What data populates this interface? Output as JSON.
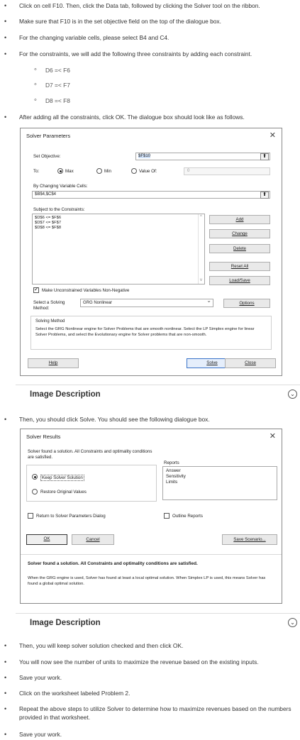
{
  "instructions": {
    "step1": "Click on cell F10. Then, click the Data tab, followed by clicking the Solver tool on the ribbon.",
    "step2": "Make sure that F10 is in the set objective field on the top of the dialogue box.",
    "step3": "For the changing variable cells, please select B4 and C4.",
    "step4": "For the constraints, we will add the following three constraints by adding each constraint.",
    "constraints": [
      "D6 =< F6",
      "D7 =< F7",
      "D8 =< F8"
    ],
    "step5": "After adding all the constraints, click OK. The dialogue box should look like as follows.",
    "step6": "Then, you should click Solve. You should see the following dialogue box.",
    "step7": "Then, you will keep solver solution checked and then click OK.",
    "step8": "You will now see the number of units to maximize the revenue based on the existing inputs.",
    "step9": "Save your work.",
    "step10": "Click on the worksheet labeled Problem 2.",
    "step11": "Repeat the above steps to utilize Solver to determine how to maximize revenues based on the numbers provided in that worksheet.",
    "step12": "Save your work."
  },
  "solver_params": {
    "title": "Solver Parameters",
    "close": "✕",
    "set_objective_label": "Set Objective:",
    "set_objective_value": "$F$10",
    "to_label": "To:",
    "max_label": "Max",
    "min_label": "Min",
    "value_of_label": "Value Of:",
    "value_of_value": "0",
    "changing_cells_label": "By Changing Variable Cells:",
    "changing_cells_value": "$B$4,$C$4",
    "constraints_label": "Subject to the Constraints:",
    "constraint_items": [
      "$D$6 <= $F$6",
      "$D$7 <= $F$7",
      "$D$8 <= $F$8"
    ],
    "add": "Add",
    "change": "Change",
    "delete": "Delete",
    "reset_all": "Reset All",
    "load_save": "Load/Save",
    "nonneg_label": "Make Unconstrained Variables Non-Negative",
    "method_label_line1": "Select a Solving",
    "method_label_line2": "Method:",
    "method_value": "GRG Nonlinear",
    "options": "Options",
    "solving_method_title": "Solving Method",
    "solving_method_text": "Select the GRG Nonlinear engine for Solver Problems that are smooth nonlinear. Select the LP Simplex engine for linear Solver Problems, and select the Evolutionary engine for Solver problems that are non-smooth.",
    "help": "Help",
    "solve": "Solve",
    "close_btn": "Close",
    "up_arrow": "⬆",
    "down_chev": "⌄"
  },
  "image_desc": {
    "label": "Image Description",
    "icon": "⌄"
  },
  "solver_results": {
    "title": "Solver Results",
    "close": "✕",
    "found_text": "Solver found a solution.  All Constraints and optimality conditions are satisfied.",
    "reports_label": "Reports",
    "reports": [
      "Answer",
      "Sensitivity",
      "Limits"
    ],
    "keep_label": "Keep Solver Solution",
    "restore_label": "Restore Original Values",
    "return_label": "Return to Solver Parameters Dialog",
    "outline_label": "Outline Reports",
    "ok": "OK",
    "cancel": "Cancel",
    "save_scenario": "Save Scenario...",
    "bold_msg": "Solver found a solution.  All Constraints and optimality conditions are satisfied.",
    "detail_msg": "When the GRG engine is used, Solver has found at least a local optimal solution. When Simplex LP is used, this means Solver has found a global optimal solution."
  }
}
